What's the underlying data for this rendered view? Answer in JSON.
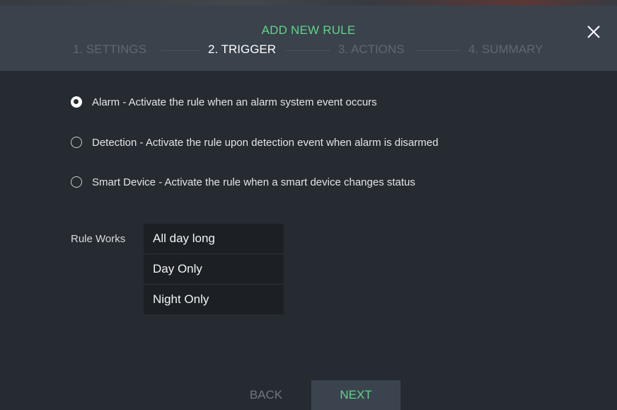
{
  "dialog": {
    "title": "ADD NEW RULE",
    "close_icon": "close-icon"
  },
  "steps": [
    {
      "label": "1. SETTINGS",
      "state": "inactive"
    },
    {
      "label": "2. TRIGGER",
      "state": "active"
    },
    {
      "label": "3. ACTIONS",
      "state": "inactive"
    },
    {
      "label": "4. SUMMARY",
      "state": "inactive"
    }
  ],
  "triggers": [
    {
      "label": "Alarm - Activate the rule when an alarm system event occurs",
      "selected": true
    },
    {
      "label": "Detection - Activate the rule upon detection event when alarm is disarmed",
      "selected": false
    },
    {
      "label": "Smart Device - Activate the rule when a smart device changes status",
      "selected": false
    }
  ],
  "rule_works": {
    "label": "Rule Works",
    "options": [
      "All day long",
      "Day Only",
      "Night Only"
    ]
  },
  "footer": {
    "back_label": "BACK",
    "next_label": "NEXT"
  },
  "colors": {
    "accent": "#5fd38a",
    "header_bg": "#3a424c",
    "body_bg": "#262b31",
    "option_bg": "#1c2025"
  }
}
